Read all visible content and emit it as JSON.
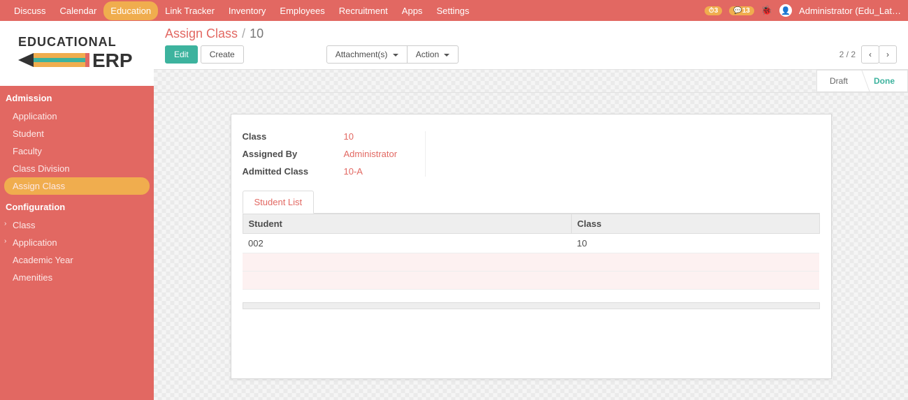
{
  "topbar": {
    "menu": [
      {
        "label": "Discuss",
        "active": false
      },
      {
        "label": "Calendar",
        "active": false
      },
      {
        "label": "Education",
        "active": true
      },
      {
        "label": "Link Tracker",
        "active": false
      },
      {
        "label": "Inventory",
        "active": false
      },
      {
        "label": "Employees",
        "active": false
      },
      {
        "label": "Recruitment",
        "active": false
      },
      {
        "label": "Apps",
        "active": false
      },
      {
        "label": "Settings",
        "active": false
      }
    ],
    "clock_badge": "3",
    "chat_badge": "13",
    "user_label": "Administrator (Edu_Lat…"
  },
  "sidebar": {
    "sections": [
      {
        "title": "Admission",
        "items": [
          {
            "label": "Application"
          },
          {
            "label": "Student"
          },
          {
            "label": "Faculty"
          },
          {
            "label": "Class Division"
          },
          {
            "label": "Assign Class",
            "active": true
          }
        ]
      },
      {
        "title": "Configuration",
        "items": [
          {
            "label": "Class",
            "expandable": true
          },
          {
            "label": "Application",
            "expandable": true
          },
          {
            "label": "Academic Year"
          },
          {
            "label": "Amenities"
          }
        ]
      }
    ]
  },
  "breadcrumb": {
    "root": "Assign Class",
    "sep": "/",
    "current": "10"
  },
  "toolbar": {
    "edit": "Edit",
    "create": "Create",
    "attach": "Attachment(s)",
    "action": "Action"
  },
  "pager": {
    "text": "2 / 2"
  },
  "status": {
    "draft": "Draft",
    "done": "Done"
  },
  "form": {
    "class_label": "Class",
    "class_val": "10",
    "assigned_label": "Assigned By",
    "assigned_val": "Administrator",
    "admitted_label": "Admitted Class",
    "admitted_val": "10-A"
  },
  "tab": {
    "student_list": "Student List"
  },
  "table": {
    "headers": {
      "student": "Student",
      "class": "Class"
    },
    "rows": [
      {
        "student": "002",
        "class": "10"
      }
    ]
  }
}
